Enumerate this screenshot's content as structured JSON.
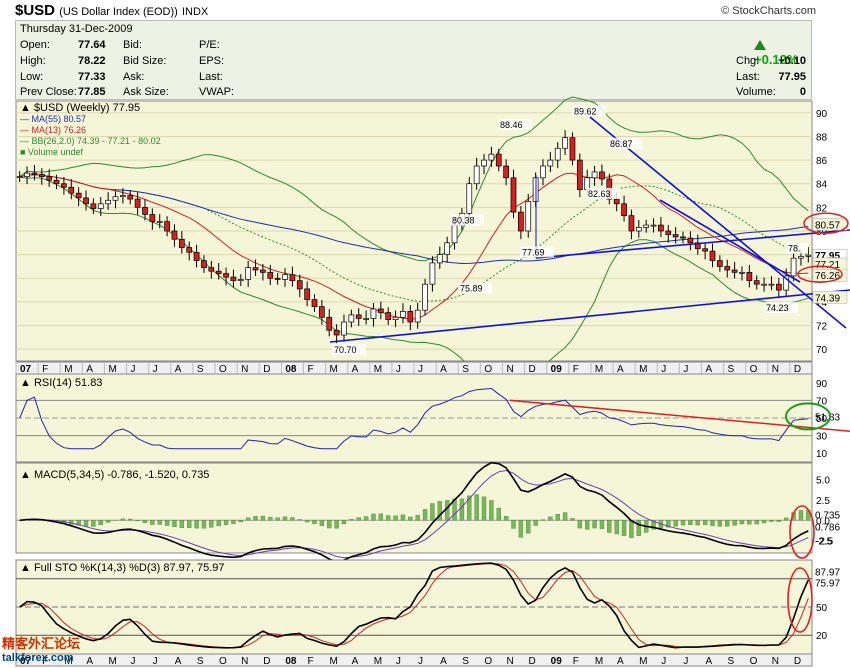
{
  "header": {
    "symbol": "$USD",
    "name": "(US Dollar Index (EOD))",
    "exchange": "INDX",
    "brand": "© StockCharts.com"
  },
  "quote": {
    "date": "Thursday  31-Dec-2009",
    "open_label": "Open:",
    "open": "77.64",
    "high_label": "High:",
    "high": "78.22",
    "low_label": "Low:",
    "low": "77.33",
    "prev_label": "Prev Close:",
    "prev": "77.85",
    "bid": "Bid:",
    "bid_size": "Bid Size:",
    "ask": "Ask:",
    "ask_size": "Ask Size:",
    "pe": "P/E:",
    "eps": "EPS:",
    "last_label2": "Last:",
    "vwap": "VWAP:",
    "pct_change": "+0.12%",
    "chg_label": "Chg:",
    "chg": "+0.10",
    "last_label": "Last:",
    "last": "77.95",
    "volume_label": "Volume:",
    "volume": "0"
  },
  "legend": {
    "price": "$USD (Weekly) 77.95",
    "ma55": "MA(55) 80.57",
    "ma13": "MA(13) 76.26",
    "bb": "BB(26,2.0) 74.39 - 77.21 - 80.02",
    "volume": "Volume undef"
  },
  "colors": {
    "up": "#ffffff",
    "down": "#d42020",
    "ma55": "#1f2fb0",
    "ma13": "#d42020",
    "bb": "#2e8a2e",
    "trend": "#1010dd",
    "rsi": "#2222aa",
    "rsi_trend": "#dd2222",
    "panel_bg": "#f5f5d8",
    "alert_circle": "#e02020",
    "rsi_circle": "#1a9a1a"
  },
  "watermark": {
    "cn": "精客外汇论坛",
    "en": "talkforex.com"
  },
  "chart_data": [
    {
      "type": "candlestick",
      "title": "$USD (Weekly)",
      "ylim": [
        69,
        91
      ],
      "y_ticks": [
        70,
        72,
        74,
        76,
        78,
        80,
        82,
        84,
        86,
        88,
        90
      ],
      "x_labels": [
        "07",
        "F",
        "M",
        "A",
        "M",
        "J",
        "J",
        "A",
        "S",
        "O",
        "N",
        "D",
        "08",
        "F",
        "M",
        "A",
        "M",
        "J",
        "J",
        "A",
        "S",
        "O",
        "N",
        "D",
        "09",
        "F",
        "M",
        "A",
        "M",
        "J",
        "J",
        "A",
        "S",
        "O",
        "N",
        "D"
      ],
      "closes": [
        84.6,
        84.9,
        84.8,
        84.6,
        84.3,
        84.0,
        83.7,
        83.2,
        82.8,
        82.3,
        81.9,
        82.3,
        82.6,
        82.9,
        83.0,
        82.7,
        82.0,
        81.4,
        80.8,
        80.8,
        80.0,
        79.3,
        78.6,
        78.2,
        77.5,
        76.9,
        76.6,
        76.4,
        76.1,
        75.8,
        75.9,
        76.9,
        76.7,
        76.5,
        76.0,
        75.9,
        76.3,
        75.8,
        75.1,
        74.2,
        73.6,
        72.7,
        71.6,
        71.2,
        72.3,
        72.9,
        72.6,
        72.6,
        73.4,
        73.1,
        72.5,
        72.7,
        73.2,
        72.3,
        73.3,
        75.5,
        77.3,
        78.0,
        79.0,
        80.5,
        81.5,
        84.0,
        85.5,
        86.0,
        86.5,
        85.5,
        84.5,
        81.6,
        80.0,
        82.5,
        84.5,
        85.5,
        86.0,
        87.0,
        87.9,
        86.0,
        83.5,
        84.5,
        85.0,
        84.4,
        82.7,
        82.3,
        81.3,
        80.0,
        80.3,
        80.5,
        80.5,
        80.0,
        79.7,
        79.5,
        79.4,
        79.0,
        78.5,
        78.3,
        77.5,
        77.0,
        76.7,
        76.5,
        76.5,
        75.8,
        75.5,
        75.5,
        75.5,
        75.0,
        76.2,
        77.7,
        77.85,
        77.95
      ],
      "annotations": [
        {
          "label": "70.70",
          "value": 70.7
        },
        {
          "label": "75.89",
          "value": 75.89
        },
        {
          "label": "80.38",
          "value": 80.38
        },
        {
          "label": "88.46",
          "value": 88.46
        },
        {
          "label": "77.69",
          "value": 77.69
        },
        {
          "label": "89.62",
          "value": 89.62
        },
        {
          "label": "86.87",
          "value": 86.87
        },
        {
          "label": "82.63",
          "value": 82.63
        },
        {
          "label": "74.23",
          "value": 74.23
        },
        {
          "label": "78.",
          "value": 78.0
        }
      ],
      "right_labels": [
        {
          "label": "80.57",
          "value": 80.57
        },
        {
          "label": "77.95",
          "value": 77.95
        },
        {
          "label": "77.21",
          "value": 77.21
        },
        {
          "label": "76.26",
          "value": 76.26
        },
        {
          "label": "74.39",
          "value": 74.39
        }
      ]
    },
    {
      "type": "line",
      "title": "RSI(14) 51.83",
      "ylim": [
        0,
        100
      ],
      "y_ticks": [
        10,
        30,
        50,
        70,
        90
      ],
      "value_label": "51.83",
      "value": 51.83
    },
    {
      "type": "line",
      "title": "MACD(5,34,5) -0.786, -1.520, 0.735",
      "ylim": [
        -4,
        7
      ],
      "y_ticks": [
        -2.5,
        0.0,
        2.5,
        5.0
      ],
      "right_labels": [
        {
          "label": "0.735",
          "value": 0.735
        },
        {
          "label": "0.786",
          "value": -0.786
        },
        {
          "label": "-2.5",
          "value": -2.5
        }
      ]
    },
    {
      "type": "line",
      "title": "Full STO %K(14,3) %D(3) 87.97, 75.97",
      "ylim": [
        0,
        100
      ],
      "y_ticks": [
        20,
        50
      ],
      "right_labels": [
        {
          "label": "87.97",
          "value": 87.97
        },
        {
          "label": "75.97",
          "value": 75.97
        }
      ]
    }
  ]
}
